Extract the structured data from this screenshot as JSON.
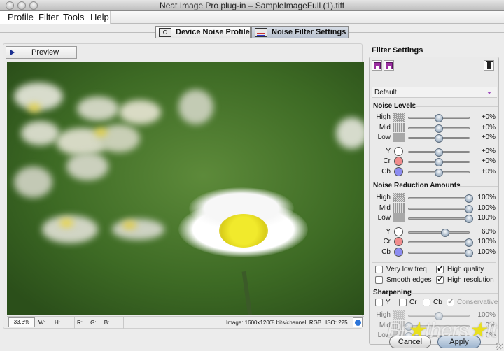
{
  "window": {
    "title": "Neat Image Pro plug-in – SampleImageFull (1).tiff"
  },
  "menu": [
    "Profile",
    "Filter",
    "Tools",
    "Help"
  ],
  "tabs": [
    {
      "label": "Device Noise Profile",
      "icon": "camera-icon",
      "active": false
    },
    {
      "label": "Noise Filter Settings",
      "icon": "sliders-icon",
      "active": true
    }
  ],
  "preview": {
    "label": "Preview"
  },
  "status": {
    "zoom": "33.3%",
    "w": "W:",
    "h": "H:",
    "r": "R:",
    "g": "G:",
    "b": "B:",
    "image": "Image: 1600x1200",
    "depth": "8 bits/channel, RGB",
    "iso": "ISO: 225"
  },
  "filter": {
    "title": "Filter Settings",
    "preset": "Default",
    "noise_levels": {
      "title": "Noise Levels",
      "rows": [
        {
          "label": "High",
          "swatch": "high",
          "value": 0.5,
          "text": "+0%"
        },
        {
          "label": "Mid",
          "swatch": "mid",
          "value": 0.5,
          "text": "+0%"
        },
        {
          "label": "Low",
          "swatch": "low",
          "value": 0.5,
          "text": "+0%"
        },
        {
          "label": "Y",
          "color": "#ffffff",
          "value": 0.5,
          "text": "+0%"
        },
        {
          "label": "Cr",
          "color": "#f08c8c",
          "value": 0.5,
          "text": "+0%"
        },
        {
          "label": "Cb",
          "color": "#8c8cf0",
          "value": 0.5,
          "text": "+0%"
        }
      ]
    },
    "reduction": {
      "title": "Noise Reduction Amounts",
      "rows": [
        {
          "label": "High",
          "swatch": "high",
          "value": 1.0,
          "text": "100%"
        },
        {
          "label": "Mid",
          "swatch": "mid",
          "value": 1.0,
          "text": "100%"
        },
        {
          "label": "Low",
          "swatch": "low",
          "value": 1.0,
          "text": "100%"
        },
        {
          "label": "Y",
          "color": "#ffffff",
          "value": 0.6,
          "text": "60%"
        },
        {
          "label": "Cr",
          "color": "#f08c8c",
          "value": 1.0,
          "text": "100%"
        },
        {
          "label": "Cb",
          "color": "#8c8cf0",
          "value": 1.0,
          "text": "100%"
        }
      ]
    },
    "options": [
      {
        "label": "Very low freq",
        "checked": false
      },
      {
        "label": "High quality",
        "checked": true
      },
      {
        "label": "Smooth edges",
        "checked": false
      },
      {
        "label": "High resolution",
        "checked": true
      }
    ],
    "sharpening": {
      "title": "Sharpening",
      "channels": [
        {
          "label": "Y",
          "checked": false
        },
        {
          "label": "Cr",
          "checked": false
        },
        {
          "label": "Cb",
          "checked": false
        },
        {
          "label": "Conservative",
          "checked": true,
          "disabled": true
        }
      ],
      "rows": [
        {
          "label": "High",
          "swatch": "high",
          "value": 0.5,
          "text": "100%"
        },
        {
          "label": "Mid",
          "swatch": "mid",
          "value": 0.0,
          "text": "0%"
        },
        {
          "label": "Low",
          "swatch": "low",
          "value": 0.0,
          "text": "0%"
        }
      ]
    }
  },
  "buttons": {
    "cancel": "Cancel",
    "apply": "Apply"
  },
  "watermark": "Brothersoft"
}
